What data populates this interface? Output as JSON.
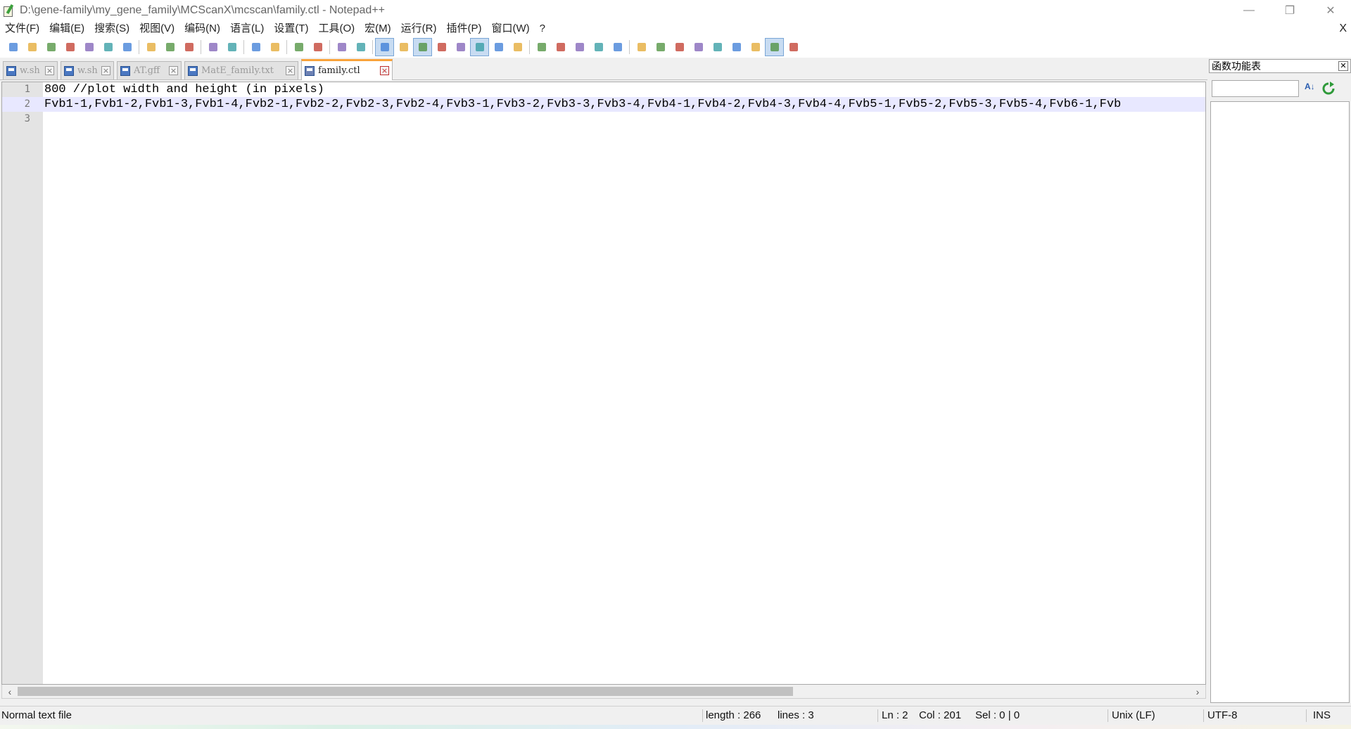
{
  "window": {
    "title": "D:\\gene-family\\my_gene_family\\MCScanX\\mcscan\\family.ctl - Notepad++",
    "minimize": "—",
    "restore": "❐",
    "close": "✕"
  },
  "menu": {
    "items": [
      "文件(F)",
      "编辑(E)",
      "搜索(S)",
      "视图(V)",
      "编码(N)",
      "语言(L)",
      "设置(T)",
      "工具(O)",
      "宏(M)",
      "运行(R)",
      "插件(P)",
      "窗口(W)",
      "?"
    ],
    "close_doc": "X"
  },
  "toolbar": {
    "buttons": [
      "new-file",
      "open-file",
      "save",
      "save-all",
      "close",
      "close-all",
      "print",
      "cut",
      "copy",
      "paste",
      "undo",
      "redo",
      "find",
      "replace",
      "zoom-in",
      "zoom-out",
      "sync-vertical",
      "sync-horizontal",
      "word-wrap",
      "show-all-chars",
      "indent-guide",
      "language-udl",
      "document-map",
      "function-list",
      "folder-as-workspace",
      "monitoring",
      "record-macro",
      "stop-macro",
      "play-macro",
      "run-macro-multiple",
      "save-macro",
      "spell-check-menu",
      "spell-check-next",
      "spell-check-prev",
      "move-up",
      "move-down",
      "go-to-last",
      "find-in-files",
      "abc-spell",
      "md-preview"
    ]
  },
  "tabs": [
    {
      "label": "w.sh",
      "active": false
    },
    {
      "label": "w.sh",
      "active": false
    },
    {
      "label": "AT.gff",
      "active": false
    },
    {
      "label": "MatE_family.txt",
      "active": false
    },
    {
      "label": "family.ctl",
      "active": true
    }
  ],
  "editor": {
    "lines": [
      {
        "num": "1",
        "text": "800 //plot width and height (in pixels)"
      },
      {
        "num": "2",
        "text": "Fvb1-1,Fvb1-2,Fvb1-3,Fvb1-4,Fvb2-1,Fvb2-2,Fvb2-3,Fvb2-4,Fvb3-1,Fvb3-2,Fvb3-3,Fvb3-4,Fvb4-1,Fvb4-2,Fvb4-3,Fvb4-4,Fvb5-1,Fvb5-2,Fvb5-3,Fvb5-4,Fvb6-1,Fvb"
      },
      {
        "num": "3",
        "text": ""
      }
    ],
    "current_line": 2,
    "scroll_left": "‹",
    "scroll_right": "›"
  },
  "function_panel": {
    "title": "函数功能表",
    "close": "✕",
    "search_value": "",
    "sort_label": "A↓"
  },
  "status": {
    "file_type": "Normal text file",
    "length": "length : 266",
    "lines": "lines : 3",
    "ln": "Ln : 2",
    "col": "Col : 201",
    "sel": "Sel : 0 | 0",
    "eol": "Unix (LF)",
    "encoding": "UTF-8",
    "mode": "INS"
  }
}
